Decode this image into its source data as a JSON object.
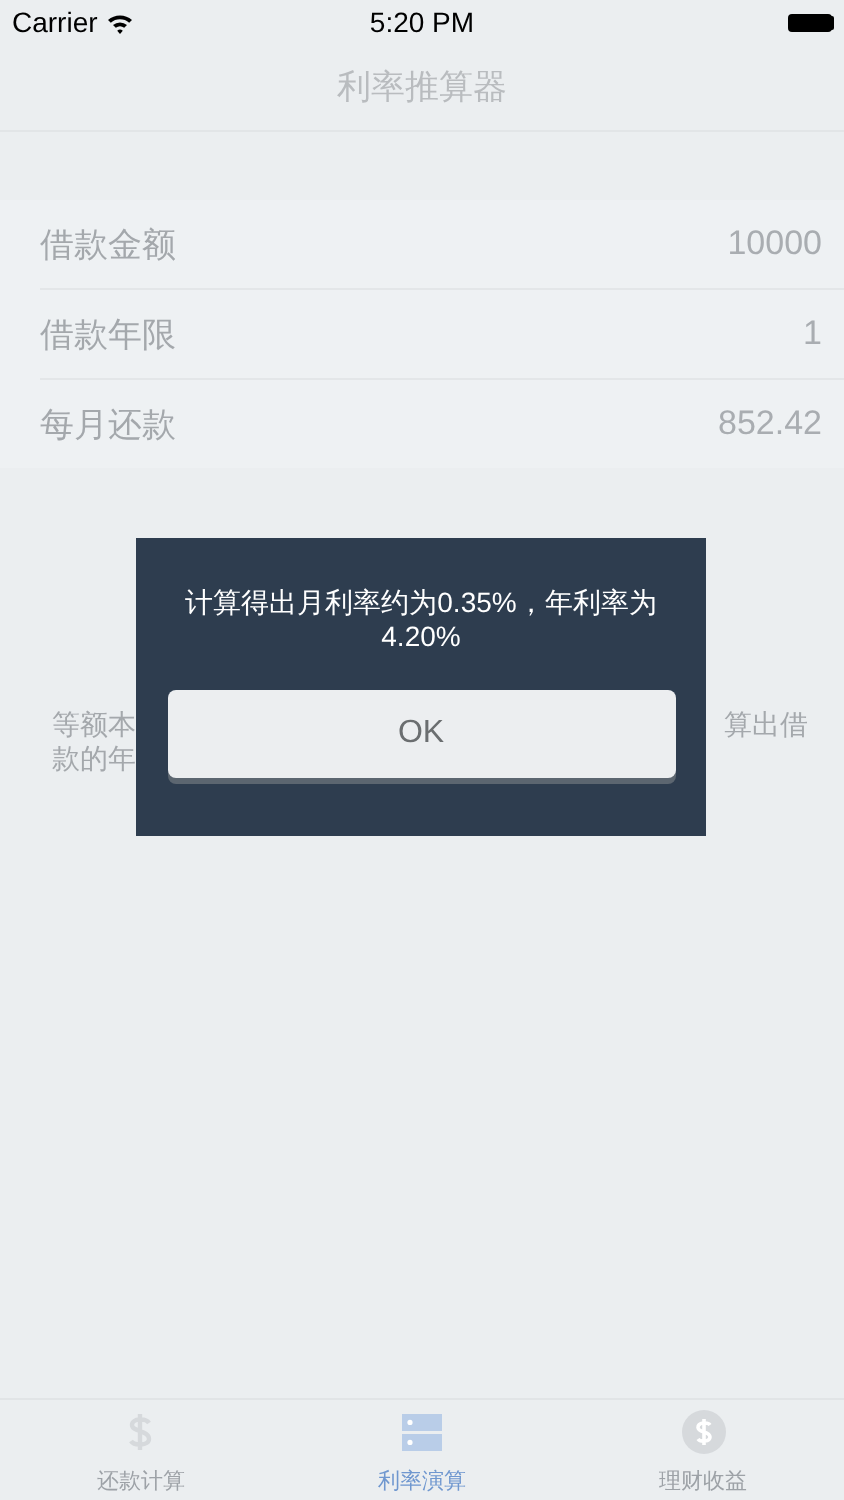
{
  "status_bar": {
    "carrier": "Carrier",
    "time": "5:20 PM"
  },
  "nav": {
    "title": "利率推算器"
  },
  "rows": [
    {
      "label": "借款金额",
      "value": "10000"
    },
    {
      "label": "借款年限",
      "value": "1"
    },
    {
      "label": "每月还款",
      "value": "852.42"
    }
  ],
  "note": {
    "left_lines": [
      "等额本",
      "款的年"
    ],
    "right_lines": [
      "算出借"
    ]
  },
  "dialog": {
    "message": "计算得出月利率约为0.35%，年利率为4.20%",
    "button": "OK"
  },
  "tabs": [
    {
      "label": "还款计算",
      "kind": "dollar",
      "selected": false
    },
    {
      "label": "利率演算",
      "kind": "server",
      "selected": true
    },
    {
      "label": "理财收益",
      "kind": "coin",
      "selected": false
    }
  ]
}
